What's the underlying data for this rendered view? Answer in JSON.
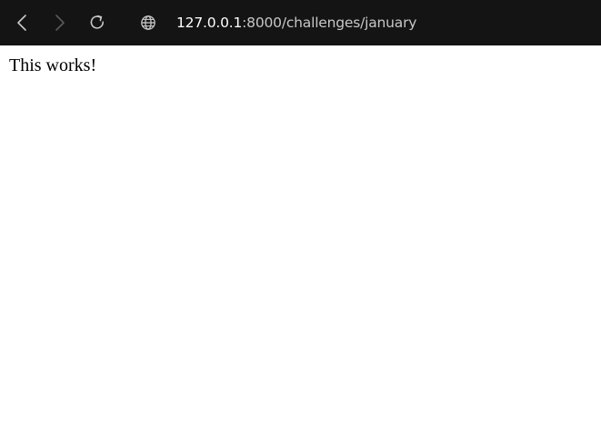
{
  "browser": {
    "url_host": "127.0.0.1",
    "url_rest": ":8000/challenges/january",
    "icons": {
      "back": "back-arrow-icon",
      "forward": "forward-arrow-icon",
      "reload": "reload-icon",
      "site_info": "globe-icon"
    },
    "colors": {
      "toolbar_bg": "#141414",
      "host_text": "#ffffff",
      "path_text": "#c7c7c7"
    }
  },
  "page": {
    "text": "This works!"
  }
}
